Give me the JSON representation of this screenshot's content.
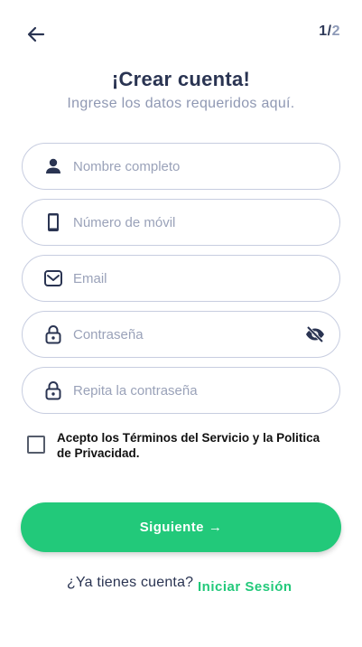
{
  "header": {
    "step_current": "1",
    "step_separator": "/",
    "step_total": "2"
  },
  "title": "¡Crear cuenta!",
  "subtitle": "Ingrese los datos requeridos aquí.",
  "fields": [
    {
      "placeholder": "Nombre completo",
      "value": "",
      "icon": "person-icon"
    },
    {
      "placeholder": "Número de móvil",
      "value": "",
      "icon": "mobile-phone-icon"
    },
    {
      "placeholder": "Email",
      "value": "",
      "icon": "mail-icon"
    },
    {
      "placeholder": "Contraseña",
      "value": "",
      "icon": "lock-icon",
      "toggle_icon": "eye-off-icon"
    },
    {
      "placeholder": "Repita la contraseña",
      "value": "",
      "icon": "lock-icon"
    }
  ],
  "terms": {
    "checked": false,
    "label": "Acepto los Términos del Servicio y la Politica de Privacidad."
  },
  "next_button": {
    "label": "Siguiente",
    "arrow": "→"
  },
  "footer": {
    "question": "¿Ya tienes cuenta?",
    "link": "Iniciar Sesión"
  },
  "colors": {
    "primary": "#22c97a",
    "title": "#2a3452",
    "subtitle": "#8f98b3",
    "border": "#c7cde0"
  }
}
